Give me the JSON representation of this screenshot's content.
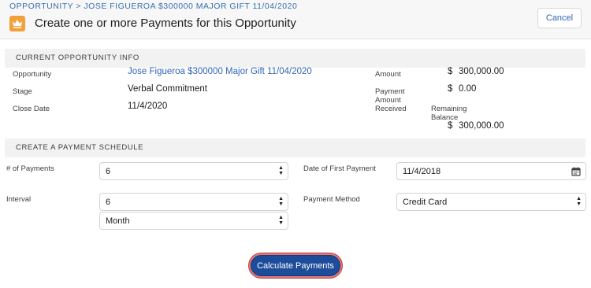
{
  "header": {
    "breadcrumb": "OPPORTUNITY > JOSE FIGUEROA $300000 MAJOR GIFT 11/04/2020",
    "title": "Create one or more Payments for this Opportunity",
    "title_icon": "crown-icon",
    "cancel_label": "Cancel"
  },
  "opportunity_info": {
    "section_title": "CURRENT OPPORTUNITY INFO",
    "opportunity_label": "Opportunity",
    "opportunity_value": "Jose Figueroa $300000 Major Gift 11/04/2020",
    "stage_label": "Stage",
    "stage_value": "Verbal Commitment",
    "close_date_label": "Close Date",
    "close_date_value": "11/4/2020",
    "amount_label": "Amount",
    "amount_currency": "$",
    "amount_value": "300,000.00",
    "received_label_1": "Payment",
    "received_label_2": "Amount",
    "received_label_3": "Received",
    "received_currency": "$",
    "received_value": "0.00",
    "remaining_label_1": "Remaining",
    "remaining_label_2": "Balance",
    "remaining_currency": "$",
    "remaining_value": "300,000.00"
  },
  "schedule": {
    "section_title": "CREATE A PAYMENT SCHEDULE",
    "num_payments_label": "# of Payments",
    "num_payments_value": "6",
    "first_payment_label": "Date of First Payment",
    "first_payment_value": "11/4/2018",
    "interval_label": "Interval",
    "interval_value": "6",
    "interval_unit_value": "Month",
    "payment_method_label": "Payment Method",
    "payment_method_value": "Credit Card"
  },
  "actions": {
    "calculate_label": "Calculate Payments"
  },
  "colors": {
    "brand": "#1c4c9a",
    "link": "#2f65b5",
    "icon": "#f2a13a"
  }
}
